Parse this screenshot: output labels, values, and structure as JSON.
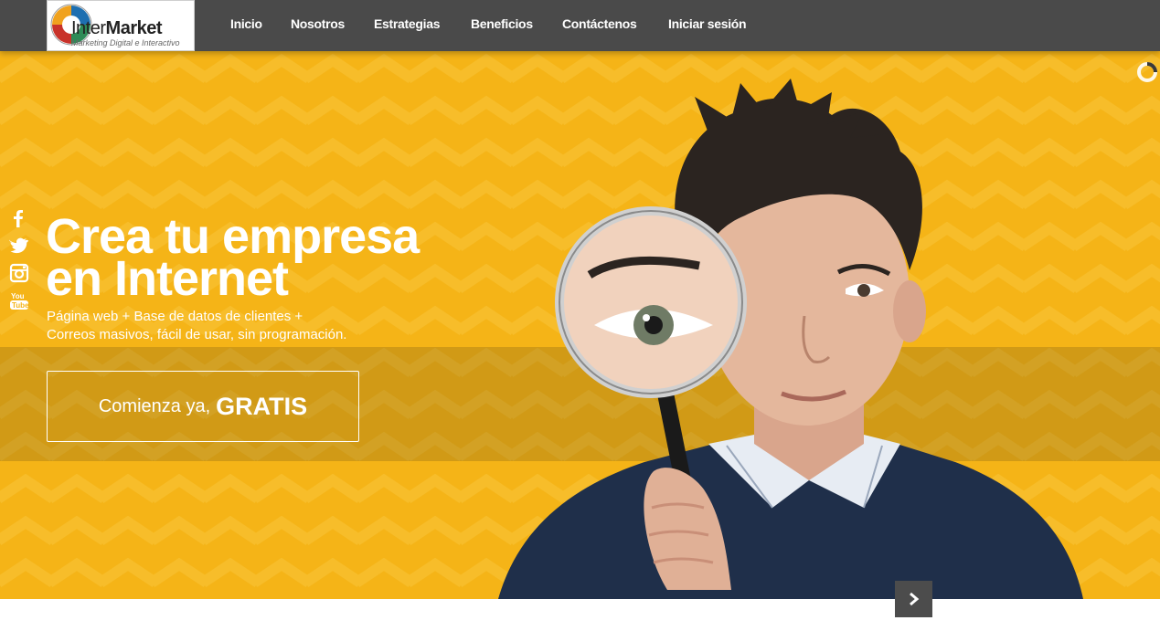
{
  "brand": {
    "name_light": "Inter",
    "name_bold": "Market",
    "tagline": "Marketing Digital e Interactivo"
  },
  "nav": {
    "items": [
      {
        "label": "Inicio"
      },
      {
        "label": "Nosotros"
      },
      {
        "label": "Estrategias"
      },
      {
        "label": "Beneficios"
      },
      {
        "label": "Contáctenos"
      },
      {
        "label": "Iniciar sesión"
      }
    ]
  },
  "hero": {
    "headline_line1": "Crea tu empresa",
    "headline_line2": "en Internet",
    "subtext_line1": "Página web + Base de datos de clientes +",
    "subtext_line2": "Correos masivos, fácil de usar, sin programación.",
    "cta_light": "Comienza ya,",
    "cta_bold": "GRATIS"
  },
  "social": {
    "icons": [
      "facebook-icon",
      "twitter-icon",
      "instagram-icon",
      "youtube-icon"
    ]
  },
  "slider": {
    "next_icon": "chevron-right-icon"
  },
  "colors": {
    "topbar": "#4a4a4a",
    "hero_yellow": "#f5b417",
    "chevron_pattern": "#f8c53a",
    "band_overlay": "#6e5014",
    "text": "#ffffff",
    "next_button": "#4c4c4c"
  }
}
